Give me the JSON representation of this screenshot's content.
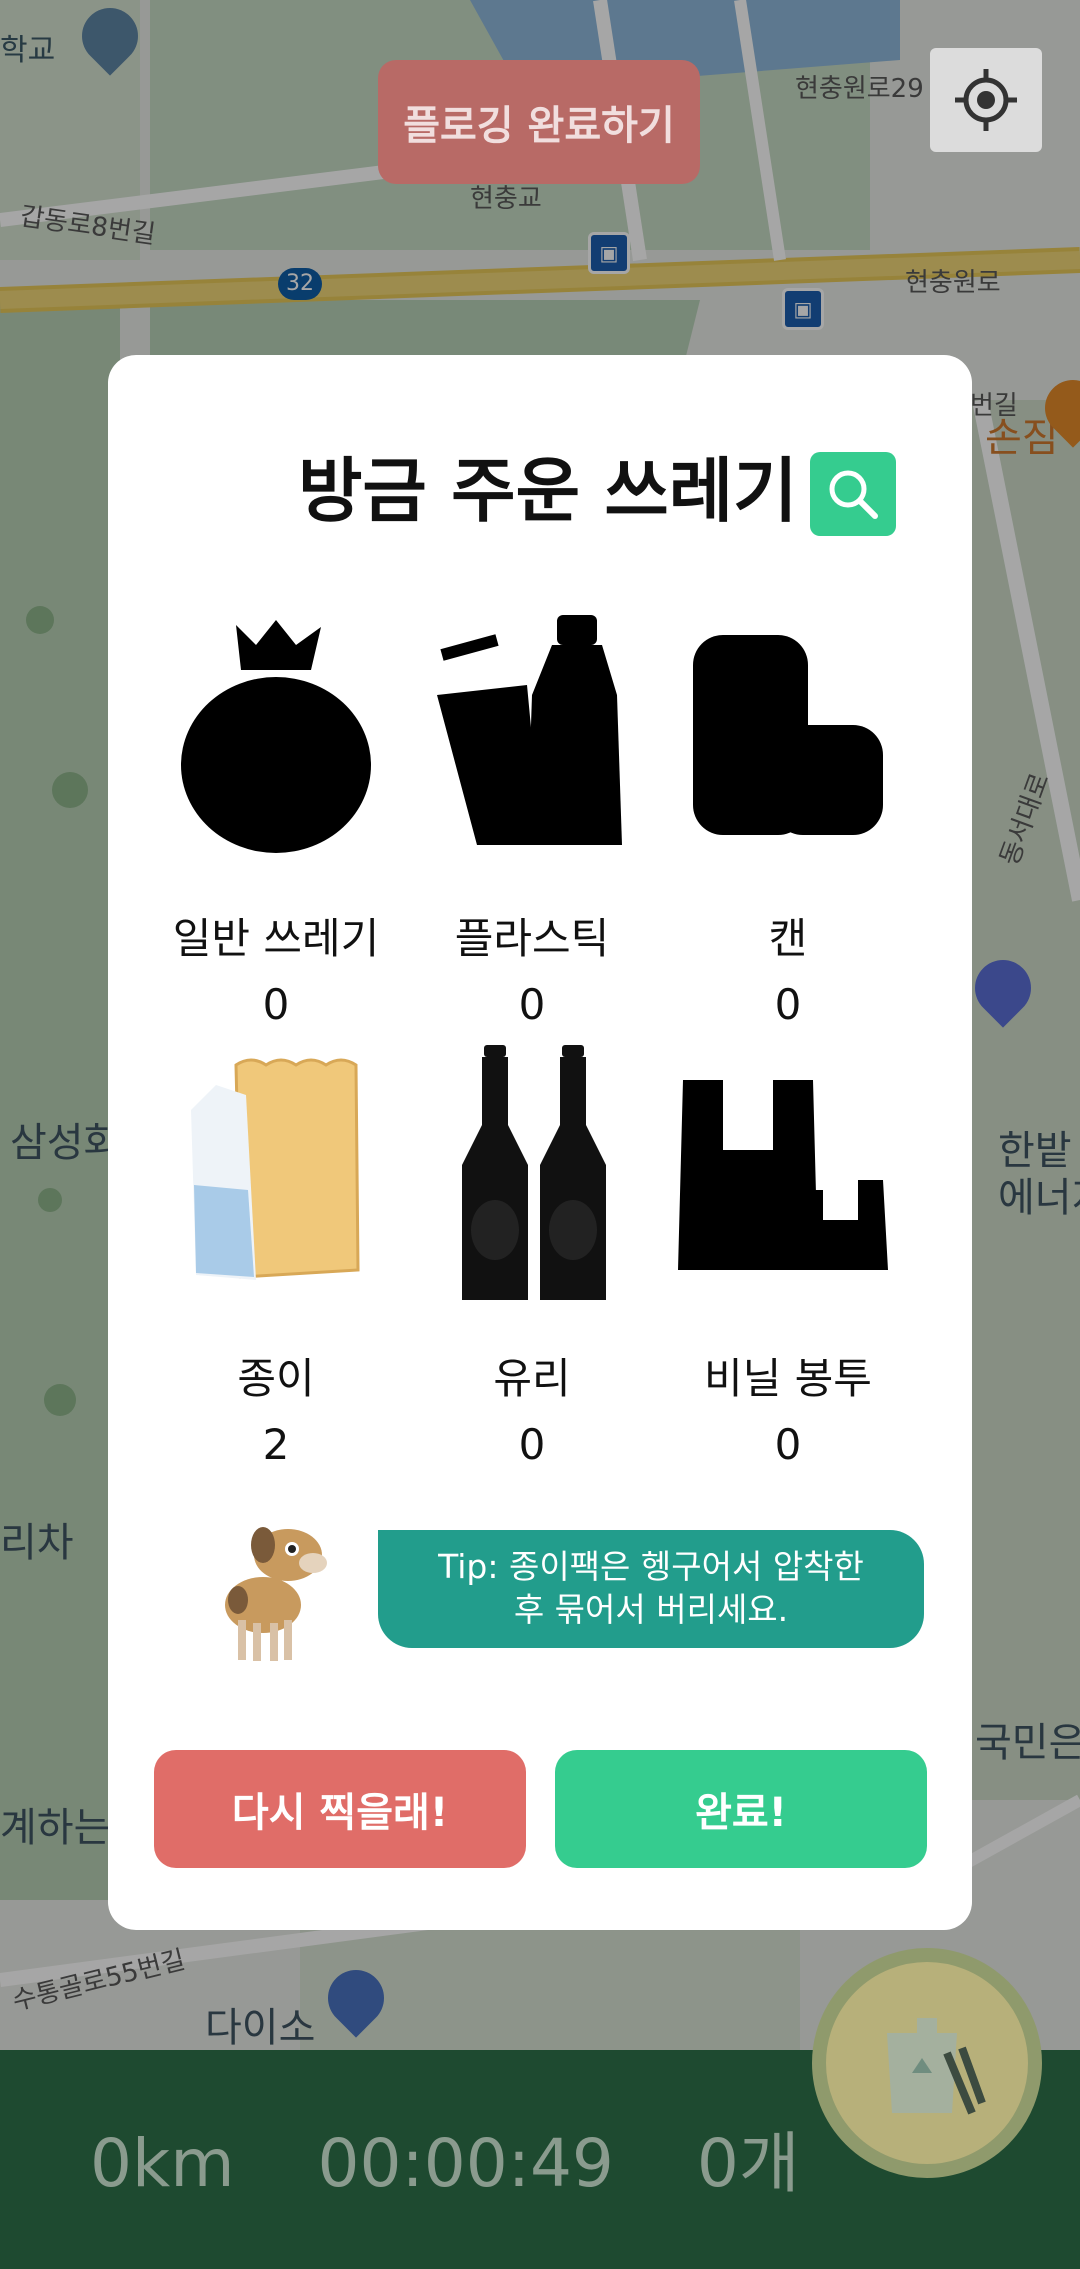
{
  "map": {
    "labels": [
      "학교",
      "현충원로29",
      "갑동로8번길",
      "현충교",
      "현충원로",
      "번길",
      "손짐",
      "동서대로",
      "삼성화",
      "한밭",
      "에너지",
      "리차",
      "국민은",
      "계하는교",
      "수통골로55번길",
      "다이소"
    ],
    "route_number": "32"
  },
  "top": {
    "finish_label": "플로깅 완료하기"
  },
  "modal": {
    "title": "방금 주운 쓰레기",
    "items": [
      {
        "label": "일반 쓰레기",
        "count": "0"
      },
      {
        "label": "플라스틱",
        "count": "0"
      },
      {
        "label": "캔",
        "count": "0"
      },
      {
        "label": "종이",
        "count": "2"
      },
      {
        "label": "유리",
        "count": "0"
      },
      {
        "label": "비닐 봉투",
        "count": "0"
      }
    ],
    "tip_line1": "Tip: 종이팩은 헹구어서 압착한",
    "tip_line2": "후 묶어서 버리세요.",
    "retry_label": "다시 찍을래!",
    "done_label": "완료!"
  },
  "stats": {
    "distance": "0km",
    "time": "00:00:49",
    "count": "0개"
  },
  "colors": {
    "accent_green": "#35cc8f",
    "retry_red": "#e06d68",
    "tip_teal": "#229d8c",
    "bar_green": "#1e4a30"
  }
}
